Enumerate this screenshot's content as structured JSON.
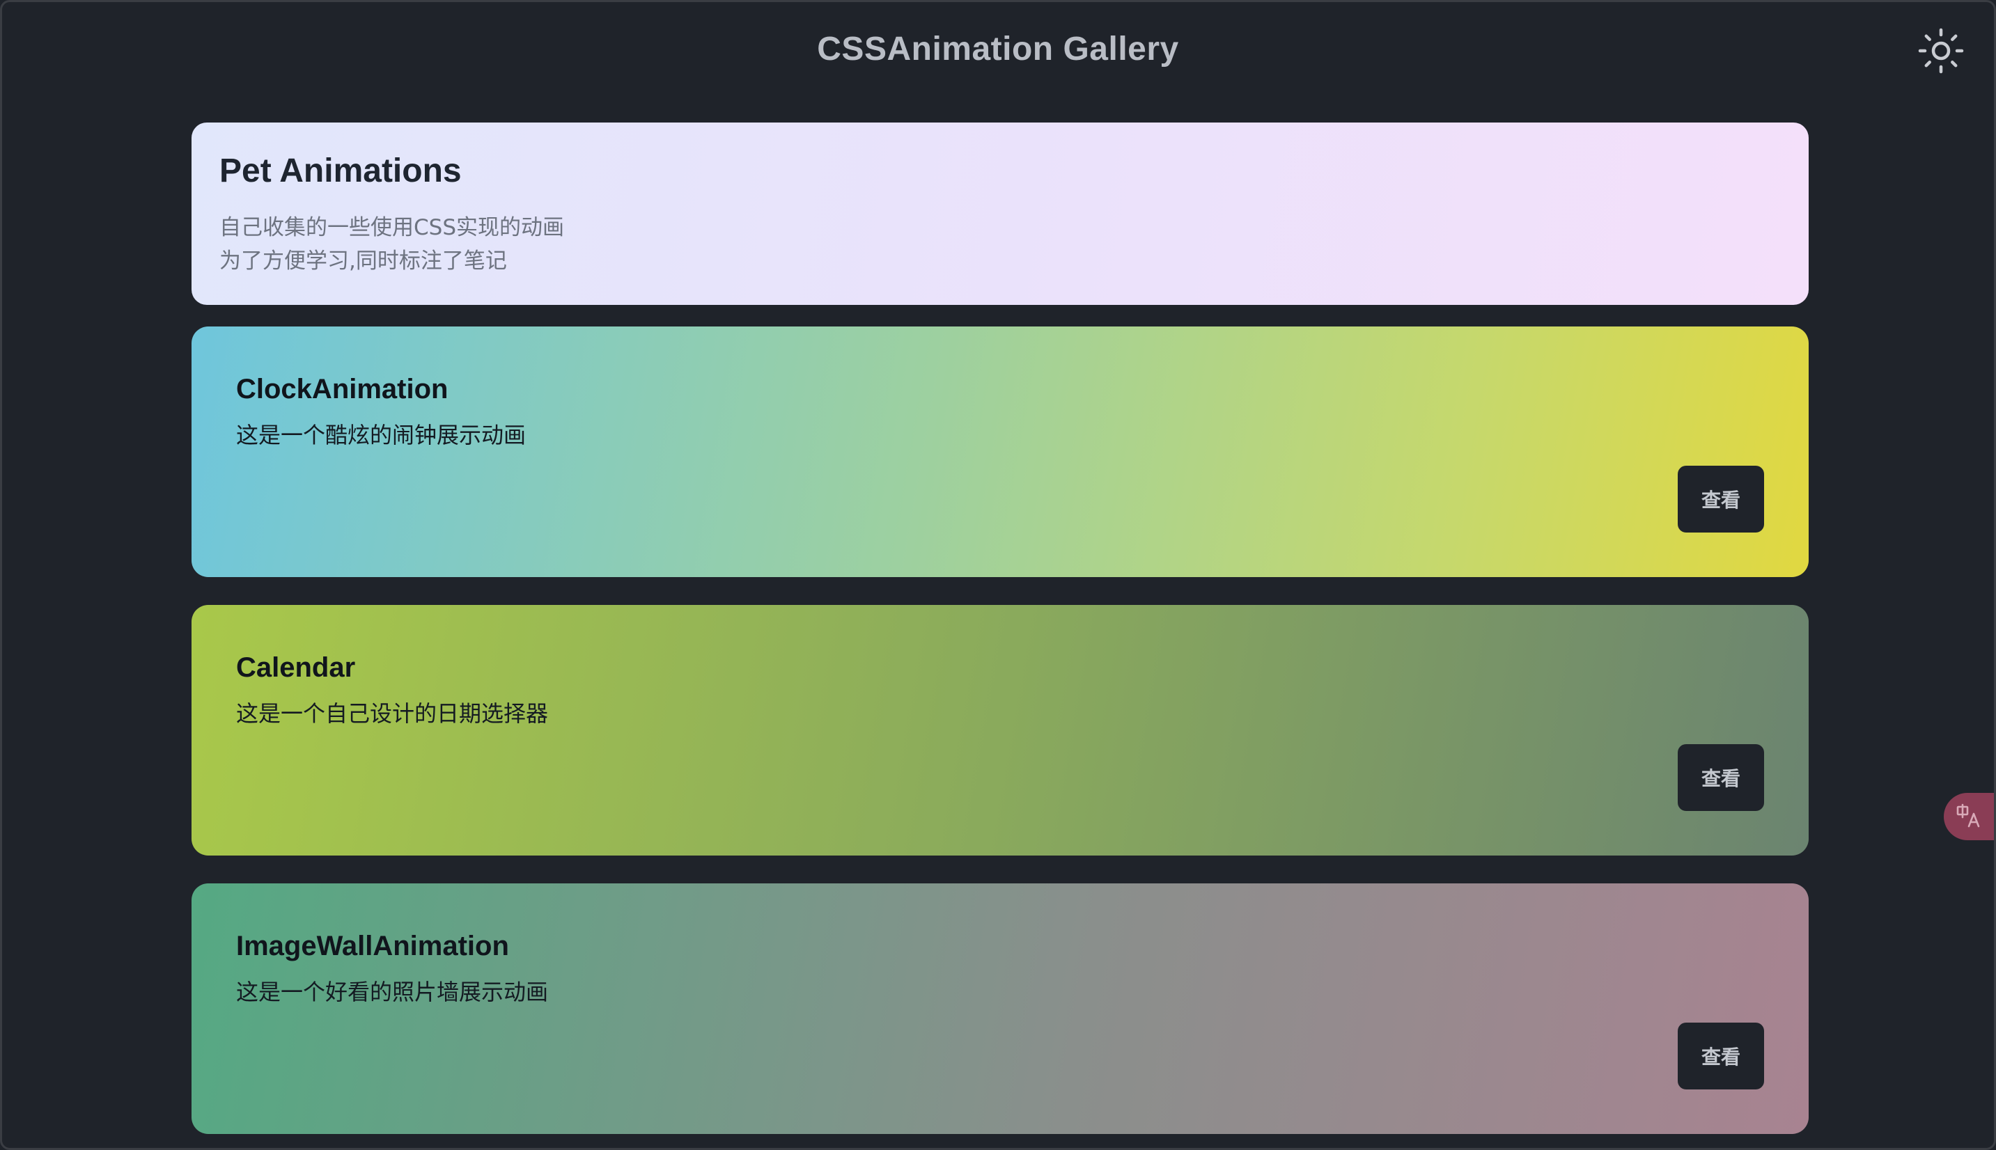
{
  "header": {
    "title": "CSSAnimation Gallery",
    "theme_toggle_icon": "sun-icon"
  },
  "intro": {
    "title": "Pet Animations",
    "lines": [
      "自己收集的一些使用CSS实现的动画",
      "为了方便学习,同时标注了笔记"
    ]
  },
  "demos": [
    {
      "title": "ClockAnimation",
      "description": "这是一个酷炫的闹钟展示动画",
      "button_label": "查看"
    },
    {
      "title": "Calendar",
      "description": "这是一个自己设计的日期选择器",
      "button_label": "查看"
    },
    {
      "title": "ImageWallAnimation",
      "description": "这是一个好看的照片墙展示动画",
      "button_label": "查看"
    }
  ],
  "floating": {
    "translate_icon": "translate-icon"
  },
  "colors": {
    "background": "#1f232a",
    "button_bg": "#1f232a",
    "title_text": "#b9bdc5",
    "translate_widget": "#8a3d55"
  }
}
